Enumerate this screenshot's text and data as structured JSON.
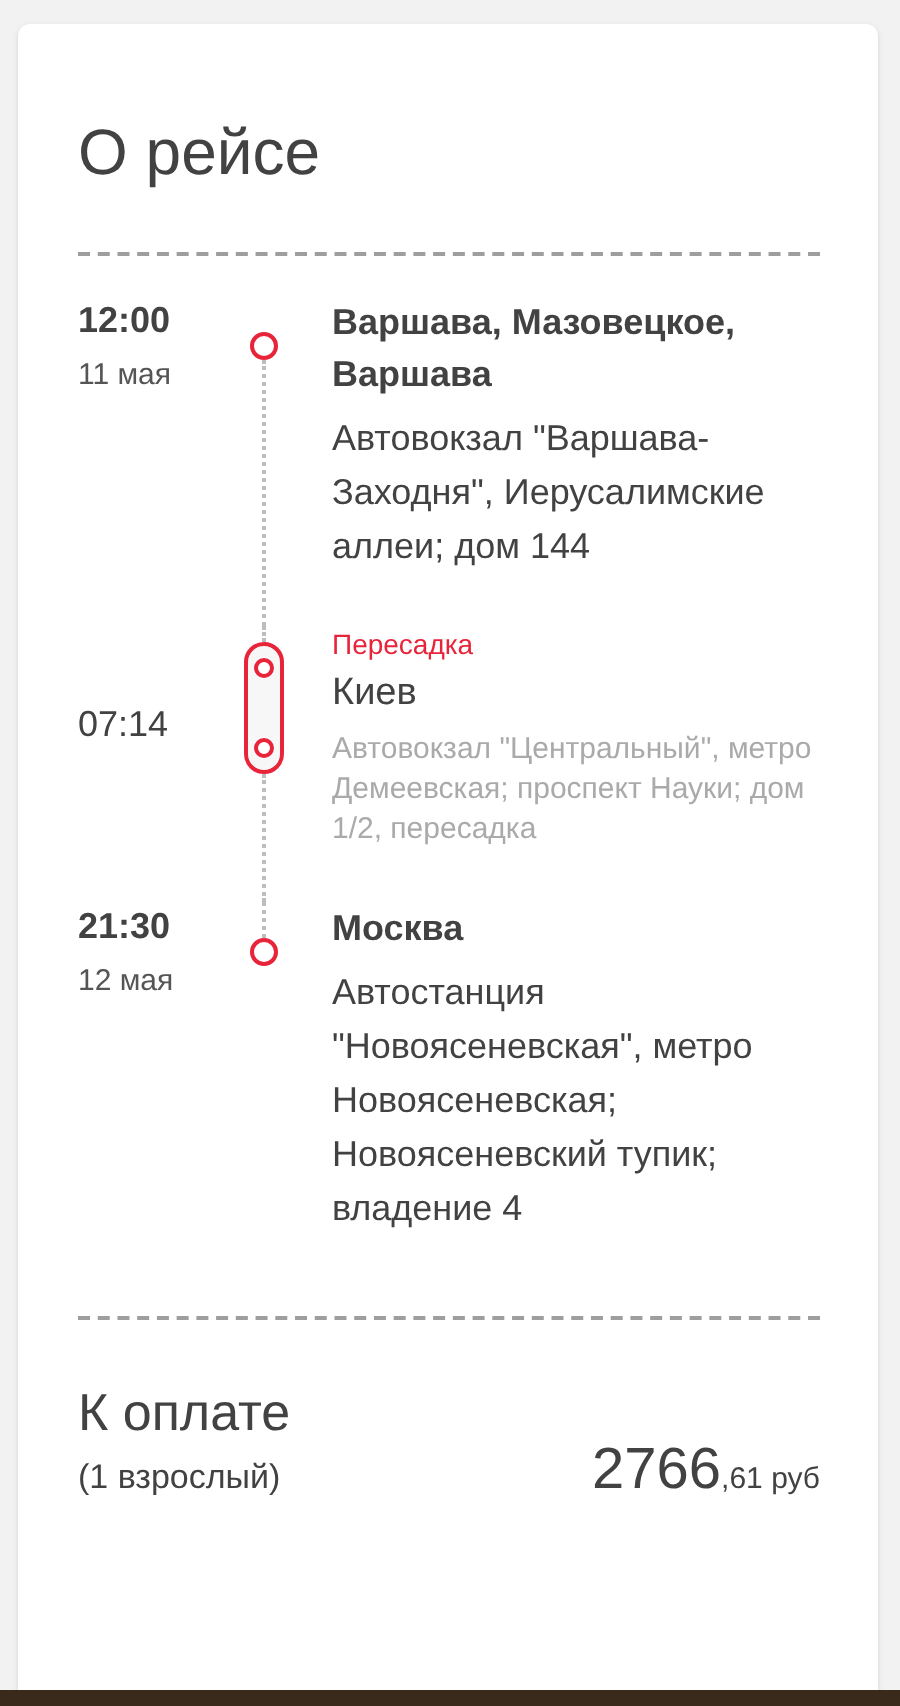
{
  "title": "О рейсе",
  "stops": [
    {
      "kind": "stop",
      "time": "12:00",
      "date": "11 мая",
      "city": "Варшава, Мазовецкое, Варшава",
      "address": "Автовокзал \"Варшава-Заходня\", Иерусалимские аллеи; дом 144"
    },
    {
      "kind": "transfer",
      "label": "Пересадка",
      "time": "07:14",
      "city": "Киев",
      "address": "Автовокзал \"Центральный\", метро Демеевская; проспект Науки; дом 1/2, пересадка"
    },
    {
      "kind": "stop",
      "time": "21:30",
      "date": "12 мая",
      "city": "Москва",
      "address": "Автостанция \"Новоясеневская\", метро Новоясеневская; Новоясеневский тупик; владение 4"
    }
  ],
  "payment": {
    "title": "К оплате",
    "passengers": "(1 взрослый)",
    "amount": "2766",
    "fraction": ",61 руб"
  }
}
